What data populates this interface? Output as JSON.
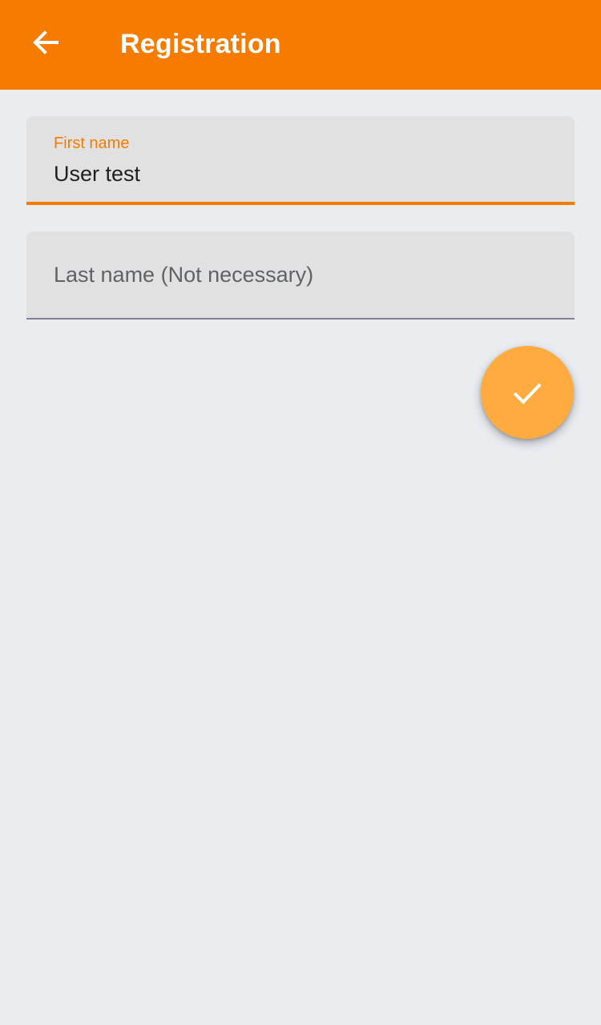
{
  "app_bar": {
    "title": "Registration",
    "back_icon": "arrow-left-icon",
    "background_color": "#f57c00"
  },
  "form": {
    "first_name": {
      "label": "First name",
      "value": "User test"
    },
    "last_name": {
      "placeholder": "Last name (Not necessary)",
      "value": ""
    }
  },
  "fab": {
    "icon": "check-icon",
    "color": "#ffab40"
  },
  "colors": {
    "accent": "#f57c00",
    "page_background": "#e9edf0",
    "field_background": "#e1e1e1"
  }
}
